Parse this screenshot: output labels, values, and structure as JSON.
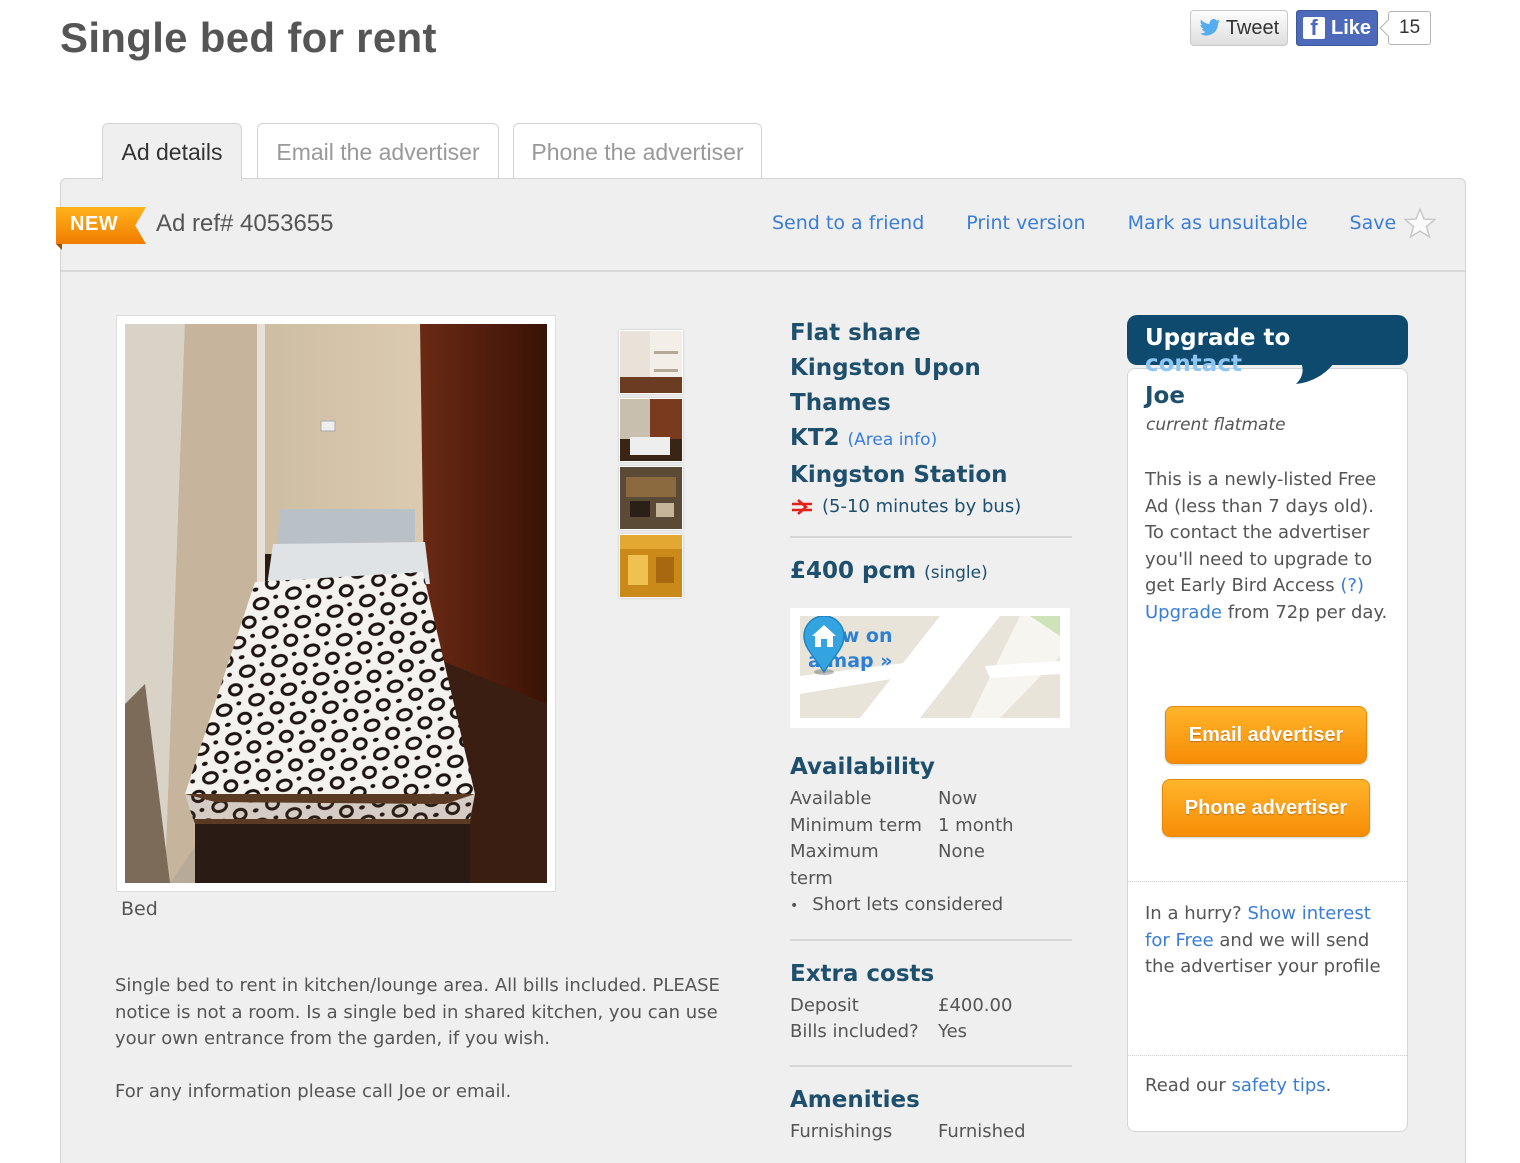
{
  "page_title": "Single bed for rent",
  "social": {
    "tweet_label": "Tweet",
    "like_label": "Like",
    "like_count": "15",
    "twitter_color": "#55acee",
    "facebook_color": "#4c69ba"
  },
  "tabs": [
    {
      "label": "Ad details",
      "active": true
    },
    {
      "label": "Email the advertiser",
      "active": false
    },
    {
      "label": "Phone the advertiser",
      "active": false
    }
  ],
  "ad_bar": {
    "badge": "NEW",
    "ad_ref": "Ad ref# 4053655",
    "links": [
      "Send to a friend",
      "Print version",
      "Mark as unsuitable",
      "Save"
    ]
  },
  "photo": {
    "caption": "Bed",
    "thumbnail_count": 4
  },
  "description": [
    "Single bed to rent in kitchen/lounge area. All bills included. PLEASE notice is not a room. Is a single bed in shared kitchen, you can use your own entrance from the garden, if you wish.",
    "For any information please call Joe or email."
  ],
  "listing": {
    "type": "Flat share",
    "area": "Kingston Upon Thames",
    "postcode": "KT2",
    "area_info_link": "(Area info)",
    "station": "Kingston Station",
    "travel": "(5-10 minutes by bus)",
    "price": "£400 pcm",
    "price_unit": "(single)",
    "map_link": "View on a map »"
  },
  "availability": {
    "heading": "Availability",
    "rows": [
      {
        "label": "Available",
        "value": "Now"
      },
      {
        "label": "Minimum term",
        "value": "1 month"
      },
      {
        "label": "Maximum term",
        "value": "None"
      }
    ],
    "note": "Short lets considered"
  },
  "extra_costs": {
    "heading": "Extra costs",
    "rows": [
      {
        "label": "Deposit",
        "value": "£400.00"
      },
      {
        "label": "Bills included?",
        "value": "Yes"
      }
    ]
  },
  "amenities": {
    "heading": "Amenities",
    "rows": [
      {
        "label": "Furnishings",
        "value": "Furnished"
      }
    ]
  },
  "contact": {
    "banner_prefix": "Upgrade to",
    "banner_highlight": "contact",
    "name": "Joe",
    "role": "current flatmate",
    "info_text": "This is a newly-listed Free Ad (less than 7 days old). To contact the advertiser you'll need to upgrade to get Early Bird Access",
    "info_help": "(?)",
    "upgrade_link": "Upgrade",
    "upgrade_price": "from 72p per day.",
    "email_button": "Email advertiser",
    "phone_button": "Phone advertiser",
    "hurry_prefix": "In a hurry?",
    "hurry_link": "Show interest for Free",
    "hurry_suffix": "and we will send the advertiser your profile",
    "safety_prefix": "Read our",
    "safety_link": "safety tips",
    "safety_suffix": "."
  },
  "colors": {
    "link": "#3a7dd8",
    "heading": "#1e4f6d",
    "badge_orange": "#f7931e",
    "banner": "#0e4a6e"
  }
}
